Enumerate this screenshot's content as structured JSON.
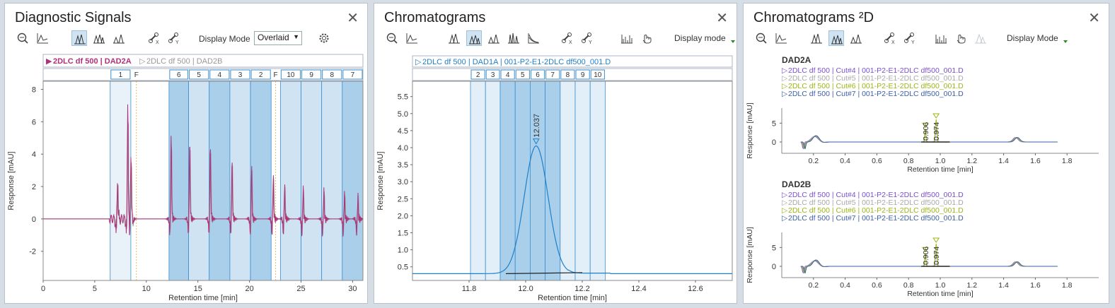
{
  "panel1": {
    "title": "Diagnostic Signals",
    "display_mode_label": "Display Mode",
    "display_mode_value": "Overlaid",
    "legend": [
      {
        "label": "2DLC df 500 | DAD2A",
        "color": "#b0307a",
        "bold": true
      },
      {
        "label": "2DLC df 500 | DAD2B",
        "color": "#999999",
        "bold": false
      }
    ],
    "fractions": [
      "1",
      "F",
      "6",
      "5",
      "4",
      "3",
      "2",
      "F",
      "10",
      "9",
      "8",
      "7"
    ]
  },
  "panel2": {
    "title": "Chromatograms",
    "display_mode_label": "Display mode",
    "legend": "2DLC df 500 | DAD1A | 001-P2-E1-2DLC df500_001.D",
    "fractions": [
      "2",
      "3",
      "4",
      "5",
      "6",
      "7",
      "8",
      "9",
      "10"
    ],
    "peak_label": "12.037"
  },
  "panel3": {
    "title": "Chromatograms ²D",
    "display_mode_label": "Display Mode",
    "plots": [
      {
        "name": "DAD2A",
        "legend": [
          "2DLC df 500 | Cut#4 | 001-P2-E1-2DLC df500_001.D",
          "2DLC df 500 | Cut#5 | 001-P2-E1-2DLC df500_001.D",
          "2DLC df 500 | Cut#6 | 001-P2-E1-2DLC df500_001.D",
          "2DLC df 500 | Cut#7 | 001-P2-E1-2DLC df500_001.D"
        ],
        "peak_labels": [
          "0.906",
          "0.974"
        ]
      },
      {
        "name": "DAD2B",
        "legend": [
          "2DLC df 500 | Cut#4 | 001-P2-E1-2DLC df500_001.D",
          "2DLC df 500 | Cut#5 | 001-P2-E1-2DLC df500_001.D",
          "2DLC df 500 | Cut#6 | 001-P2-E1-2DLC df500_001.D",
          "2DLC df 500 | Cut#7 | 001-P2-E1-2DLC df500_001.D"
        ],
        "peak_labels": [
          "0.906",
          "0.974"
        ]
      }
    ],
    "legend_colors": [
      "#7a4fd0",
      "#a9a9a9",
      "#9bb514",
      "#3d5fa8"
    ]
  },
  "chart_data": [
    {
      "type": "line",
      "title": "Diagnostic Signals",
      "xlabel": "Retention time [min]",
      "ylabel": "Response [mAU]",
      "xlim": [
        0,
        31
      ],
      "ylim": [
        -3.8,
        8.5
      ],
      "xticks": [
        0,
        5,
        10,
        15,
        20,
        25,
        30
      ],
      "yticks": [
        -2,
        0,
        2,
        4,
        6,
        8
      ],
      "series": [
        {
          "name": "2DLC df 500 | DAD2A",
          "color": "#b0307a"
        },
        {
          "name": "2DLC df 500 | DAD2B",
          "color": "#999999"
        }
      ],
      "fraction_windows": [
        {
          "label": "1",
          "x": [
            6.5,
            8.5
          ]
        },
        {
          "label": "6",
          "x": [
            12.2,
            14.1
          ]
        },
        {
          "label": "5",
          "x": [
            14.1,
            16.1
          ]
        },
        {
          "label": "4",
          "x": [
            16.1,
            18.1
          ]
        },
        {
          "label": "3",
          "x": [
            18.1,
            20.1
          ]
        },
        {
          "label": "2",
          "x": [
            20.1,
            22.1
          ]
        },
        {
          "label": "10",
          "x": [
            23.0,
            25.0
          ]
        },
        {
          "label": "9",
          "x": [
            25.0,
            27.0
          ]
        },
        {
          "label": "8",
          "x": [
            27.0,
            29.0
          ]
        },
        {
          "label": "7",
          "x": [
            29.0,
            31.0
          ]
        }
      ]
    },
    {
      "type": "line",
      "title": "Chromatograms",
      "xlabel": "Retention time [min]",
      "ylabel": "Response [mAU]",
      "xlim": [
        11.6,
        12.73
      ],
      "ylim": [
        0.1,
        5.95
      ],
      "xticks": [
        11.8,
        12.0,
        12.2,
        12.4,
        12.6
      ],
      "yticks": [
        0.5,
        1.0,
        1.5,
        2.0,
        2.5,
        3.0,
        3.5,
        4.0,
        4.5,
        5.0,
        5.5
      ],
      "series": [
        {
          "name": "2DLC df 500 | DAD1A | 001-P2-E1-2DLC df500_001.D",
          "peak_x": 12.037,
          "peak_y": 4.05,
          "baseline": 0.3,
          "color": "#1f80c8"
        }
      ],
      "fraction_windows": [
        {
          "label": "2",
          "x": [
            11.805,
            11.858
          ]
        },
        {
          "label": "3",
          "x": [
            11.858,
            11.91
          ]
        },
        {
          "label": "4",
          "x": [
            11.91,
            11.963
          ]
        },
        {
          "label": "5",
          "x": [
            11.963,
            12.016
          ]
        },
        {
          "label": "6",
          "x": [
            12.016,
            12.069
          ]
        },
        {
          "label": "7",
          "x": [
            12.069,
            12.122
          ]
        },
        {
          "label": "8",
          "x": [
            12.122,
            12.175
          ]
        },
        {
          "label": "9",
          "x": [
            12.175,
            12.228
          ]
        },
        {
          "label": "10",
          "x": [
            12.228,
            12.281
          ]
        }
      ]
    },
    {
      "type": "line",
      "title": "DAD2A",
      "xlabel": "Retention time [min]",
      "ylabel": "Response [mAU]",
      "xlim": [
        0,
        2.0
      ],
      "ylim": [
        -3,
        9
      ],
      "xticks": [
        0.2,
        0.4,
        0.6,
        0.8,
        1.0,
        1.2,
        1.4,
        1.6,
        1.8
      ],
      "yticks": [
        0,
        5
      ]
    },
    {
      "type": "line",
      "title": "DAD2B",
      "xlabel": "Retention time [min]",
      "ylabel": "Response [mAU]",
      "xlim": [
        0,
        2.0
      ],
      "ylim": [
        -3,
        9
      ],
      "xticks": [
        0.2,
        0.4,
        0.6,
        0.8,
        1.0,
        1.2,
        1.4,
        1.6,
        1.8
      ],
      "yticks": [
        0,
        5
      ]
    }
  ]
}
